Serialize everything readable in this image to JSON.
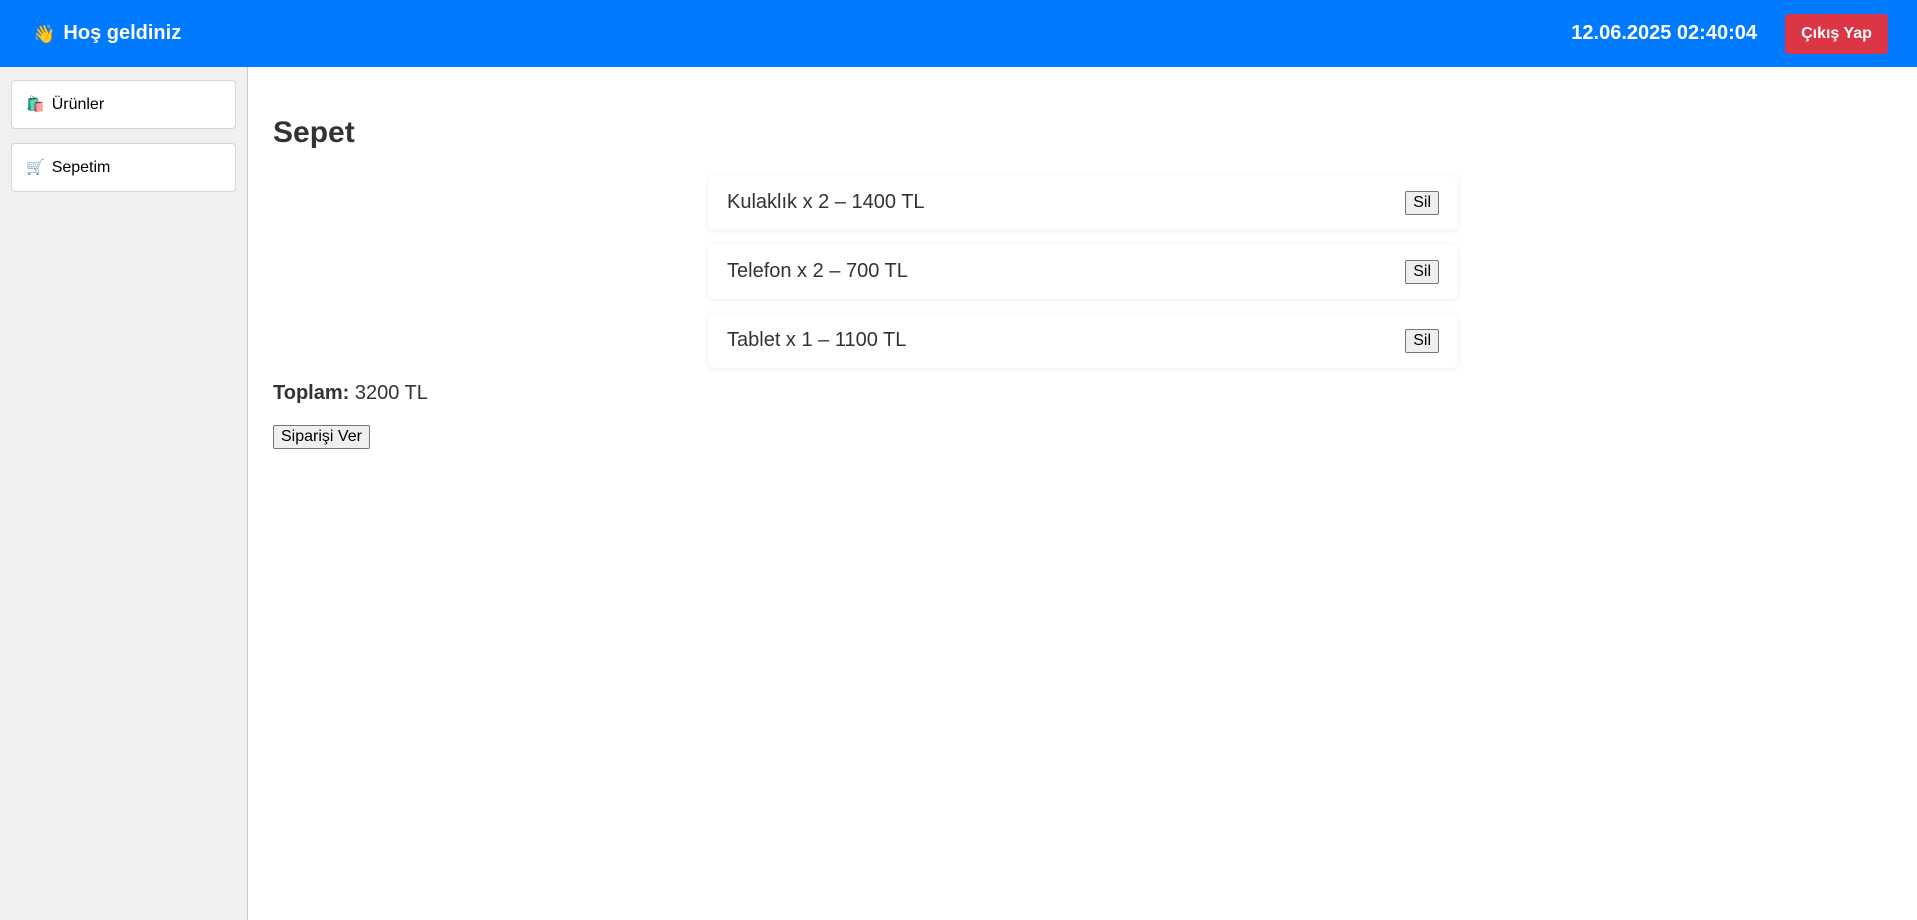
{
  "header": {
    "welcome_icon": "waving-hand-icon",
    "welcome_emoji": "👋",
    "welcome_text": "Hoş geldiniz",
    "datetime": "12.06.2025 02:40:04",
    "logout_label": "Çıkış Yap",
    "accent_color": "#007bff",
    "logout_color": "#dc3545"
  },
  "sidebar": {
    "items": [
      {
        "icon": "shopping-bags-icon",
        "emoji": "🛍️",
        "label": "Ürünler"
      },
      {
        "icon": "shopping-cart-icon",
        "emoji": "🛒",
        "label": "Sepetim"
      }
    ]
  },
  "main": {
    "title": "Sepet",
    "cart_items": [
      {
        "text": "Kulaklık x 2 – 1400 TL",
        "remove_label": "Sil"
      },
      {
        "text": "Telefon x 2 – 700 TL",
        "remove_label": "Sil"
      },
      {
        "text": "Tablet x 1 – 1100 TL",
        "remove_label": "Sil"
      }
    ],
    "total_label": "Toplam:",
    "total_value": "3200 TL",
    "order_button_label": "Siparişi Ver"
  }
}
